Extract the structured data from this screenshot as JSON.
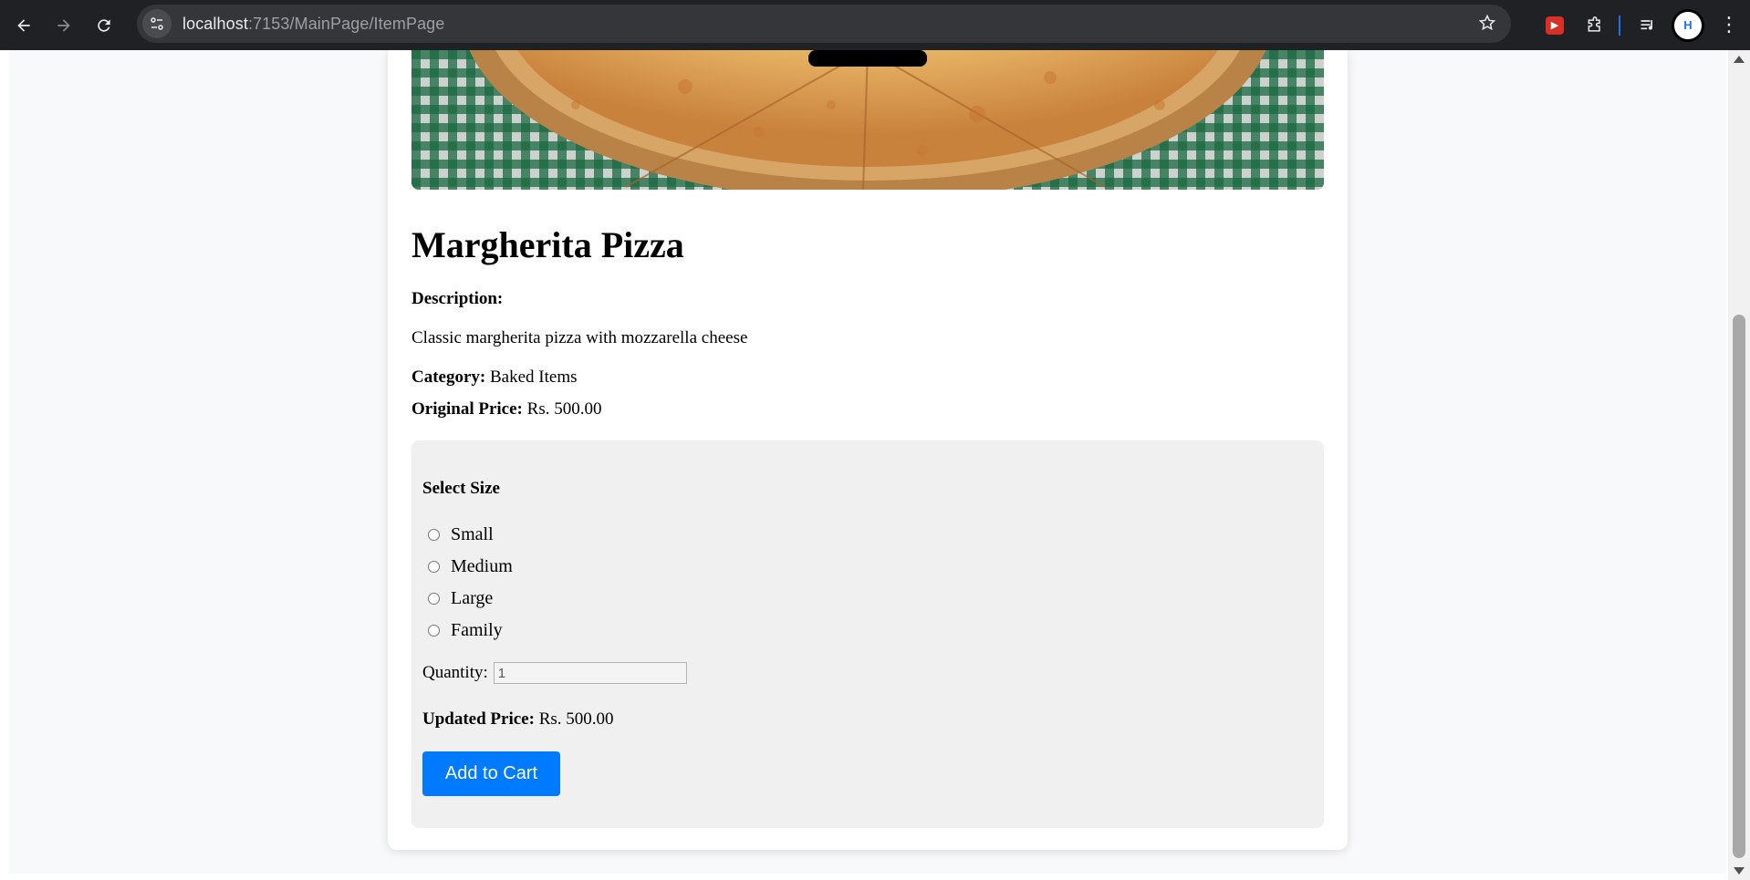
{
  "browser": {
    "url_host": "localhost",
    "url_path": ":7153/MainPage/ItemPage",
    "profile_initial": "H"
  },
  "item": {
    "name": "Margherita Pizza",
    "description_label": "Description:",
    "description": "Classic margherita pizza with mozzarella cheese",
    "category_label": "Category:",
    "category": "Baked Items",
    "price_label": "Original Price:",
    "price": "Rs. 500.00"
  },
  "options": {
    "title": "Select Size",
    "sizes": [
      "Small",
      "Medium",
      "Large",
      "Family"
    ],
    "quantity_label": "Quantity:",
    "quantity_value": "1",
    "updated_label": "Updated Price:",
    "updated_price": "Rs. 500.00",
    "add_to_cart_label": "Add to Cart"
  },
  "colors": {
    "primary_button": "#007bff",
    "page_background": "#f8f9fa",
    "options_panel": "#f0f0f0"
  }
}
